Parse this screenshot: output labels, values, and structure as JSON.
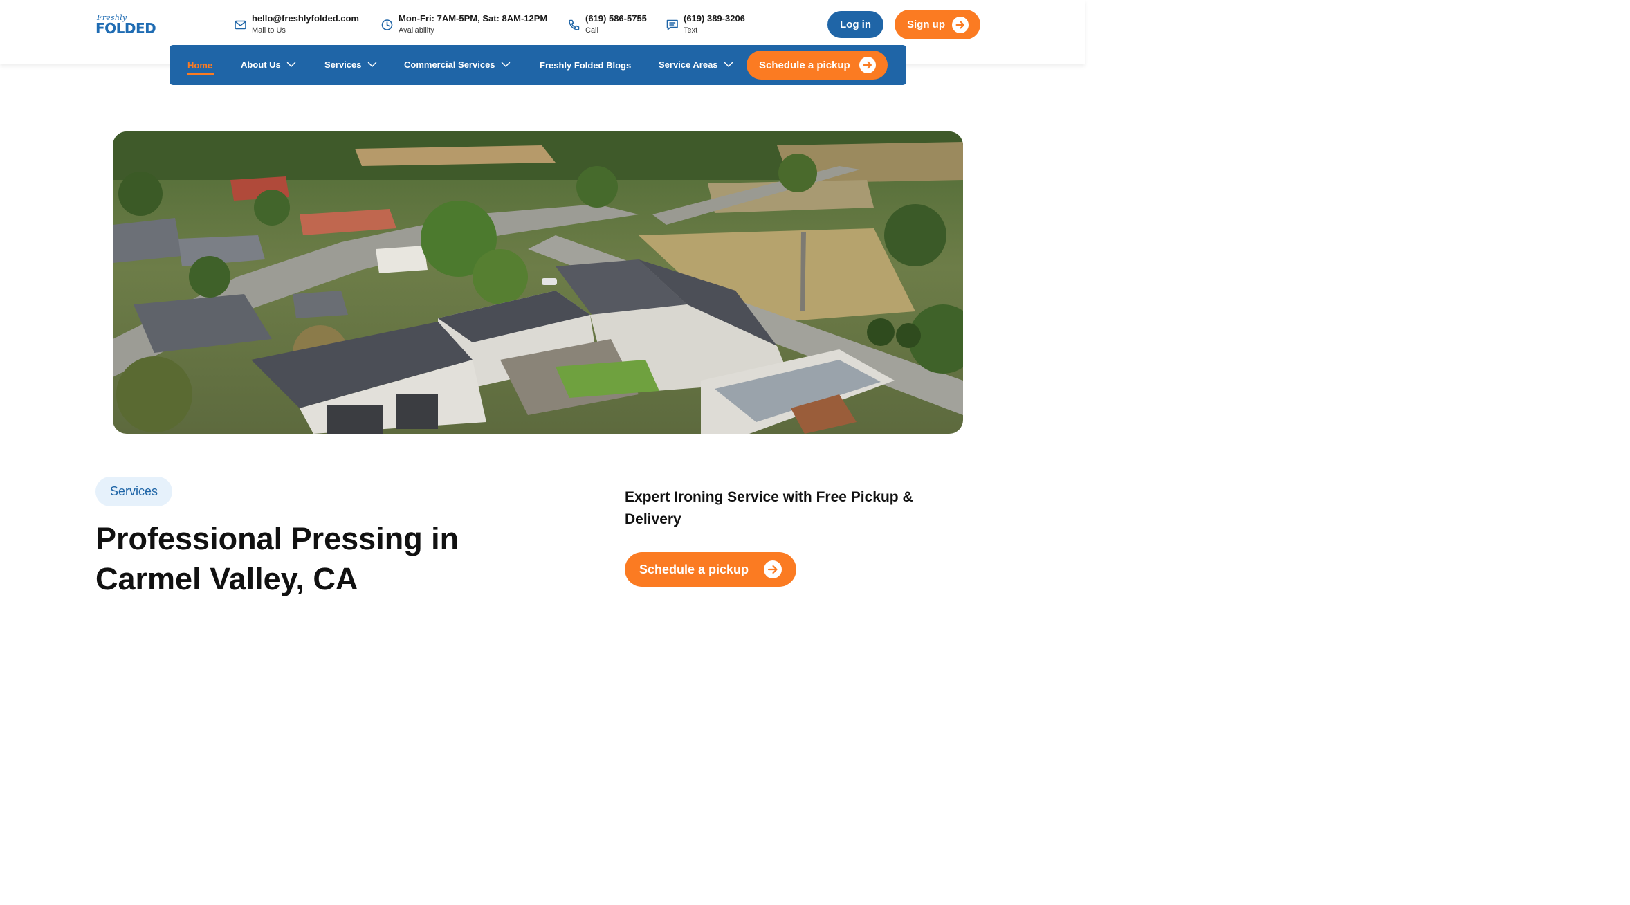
{
  "logo": {
    "script_text": "Freshly",
    "word_text": "FOLDED"
  },
  "contacts": [
    {
      "main": "hello@freshlyfolded.com",
      "sub": "Mail to Us",
      "icon": "mail-icon"
    },
    {
      "main": "Mon-Fri: 7AM-5PM, Sat: 8AM-12PM",
      "sub": "Availability",
      "icon": "clock-icon"
    },
    {
      "main": "(619) 586-5755",
      "sub": "Call",
      "icon": "phone-icon"
    },
    {
      "main": "(619) 389-3206",
      "sub": "Text",
      "icon": "message-icon"
    }
  ],
  "auth": {
    "login": "Log in",
    "signup": "Sign up"
  },
  "nav": {
    "items": [
      {
        "label": "Home",
        "active": true,
        "dropdown": false
      },
      {
        "label": "About Us",
        "dropdown": true
      },
      {
        "label": "Services",
        "dropdown": true
      },
      {
        "label": "Commercial Services",
        "dropdown": true
      },
      {
        "label": "Freshly Folded Blogs",
        "dropdown": false
      },
      {
        "label": "Service Areas",
        "dropdown": true
      }
    ],
    "cta": "Schedule a pickup"
  },
  "hero": {
    "image_subject": "aerial photo of a residential neighborhood with houses and trees"
  },
  "content": {
    "tag": "Services",
    "title": "Professional Pressing in Carmel Valley, CA",
    "subhead": "Expert Ironing Service with Free Pickup & Delivery",
    "cta": "Schedule a pickup"
  },
  "colors": {
    "brand_blue": "#1f65a7",
    "accent_orange": "#fb7b22",
    "tag_bg": "#e6f1fb",
    "text_dark": "#111111"
  }
}
